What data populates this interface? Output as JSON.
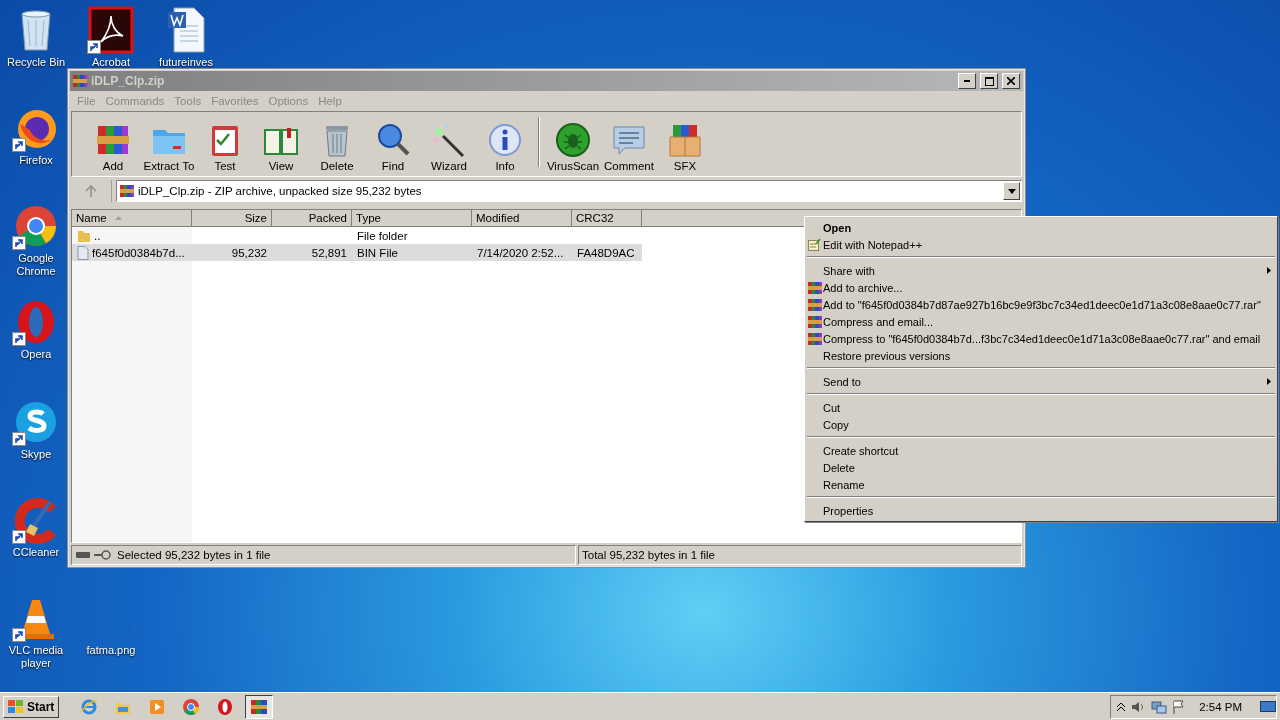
{
  "desktop_icons": [
    {
      "label": "Recycle Bin",
      "kind": "recycle",
      "shortcut": false
    },
    {
      "label": "Acrobat",
      "kind": "acrobat",
      "shortcut": true
    },
    {
      "label": "futureinves",
      "kind": "word",
      "shortcut": false
    },
    {
      "label": "Firefox",
      "kind": "firefox",
      "shortcut": true
    },
    {
      "label": "Google Chrome",
      "kind": "chrome",
      "shortcut": true
    },
    {
      "label": "Opera",
      "kind": "opera",
      "shortcut": true
    },
    {
      "label": "Skype",
      "kind": "skype",
      "shortcut": true
    },
    {
      "label": "CCleaner",
      "kind": "ccleaner",
      "shortcut": true
    },
    {
      "label": "VLC media player",
      "kind": "vlc",
      "shortcut": true
    },
    {
      "label": "fatma.png",
      "kind": "image",
      "shortcut": false
    }
  ],
  "window": {
    "title": "iDLP_Clp.zip",
    "menu": [
      {
        "label": "File",
        "disabled": true
      },
      {
        "label": "Commands",
        "disabled": true
      },
      {
        "label": "Tools",
        "disabled": true
      },
      {
        "label": "Favorites",
        "disabled": true
      },
      {
        "label": "Options",
        "disabled": true
      },
      {
        "label": "Help",
        "disabled": true
      }
    ],
    "toolbar": [
      {
        "label": "Add",
        "kind": "add"
      },
      {
        "label": "Extract To",
        "kind": "extract"
      },
      {
        "label": "Test",
        "kind": "test"
      },
      {
        "label": "View",
        "kind": "view"
      },
      {
        "label": "Delete",
        "kind": "delete"
      },
      {
        "label": "Find",
        "kind": "find"
      },
      {
        "label": "Wizard",
        "kind": "wizard"
      },
      {
        "label": "Info",
        "kind": "info"
      },
      {
        "kind": "separator"
      },
      {
        "label": "VirusScan",
        "kind": "virus"
      },
      {
        "label": "Comment",
        "kind": "comment"
      },
      {
        "label": "SFX",
        "kind": "sfx"
      }
    ],
    "address": "iDLP_Clp.zip - ZIP archive, unpacked size 95,232 bytes",
    "columns": [
      {
        "label": "Name",
        "sorted": true
      },
      {
        "label": "Size",
        "sorted": false
      },
      {
        "label": "Packed",
        "sorted": false
      },
      {
        "label": "Type",
        "sorted": false
      },
      {
        "label": "Modified",
        "sorted": false
      },
      {
        "label": "CRC32",
        "sorted": false
      }
    ],
    "rows": [
      {
        "kind": "folder",
        "name": "..",
        "type": "File folder",
        "selected": false
      },
      {
        "kind": "file",
        "name": "f645f0d0384b7d...",
        "size": "95,232",
        "packed": "52,891",
        "type": "BIN File",
        "modified": "7/14/2020 2:52...",
        "crc32": "FA48D9AC",
        "selected": true
      }
    ],
    "status_left": "Selected 95,232 bytes in 1 file",
    "status_right": "Total 95,232 bytes in 1 file"
  },
  "context_menu": [
    {
      "kind": "item",
      "label": "Open",
      "default": true
    },
    {
      "kind": "notepad_item",
      "label": "Edit with Notepad++"
    },
    {
      "kind": "separator"
    },
    {
      "kind": "item",
      "label": "Share with",
      "submenu": true
    },
    {
      "kind": "archive_item",
      "label": "Add to archive..."
    },
    {
      "kind": "archive_item",
      "label": "Add to \"f645f0d0384b7d87ae927b16bc9e9f3bc7c34ed1deec0e1d71a3c08e8aae0c77.rar\""
    },
    {
      "kind": "archive_item",
      "label": "Compress and email..."
    },
    {
      "kind": "archive_item",
      "label": "Compress to \"f645f0d0384b7d...f3bc7c34ed1deec0e1d71a3c08e8aae0c77.rar\" and email"
    },
    {
      "kind": "item",
      "label": "Restore previous versions"
    },
    {
      "kind": "separator"
    },
    {
      "kind": "item",
      "label": "Send to",
      "submenu": true
    },
    {
      "kind": "separator"
    },
    {
      "kind": "item",
      "label": "Cut"
    },
    {
      "kind": "item",
      "label": "Copy"
    },
    {
      "kind": "separator"
    },
    {
      "kind": "item",
      "label": "Create shortcut"
    },
    {
      "kind": "item",
      "label": "Delete"
    },
    {
      "kind": "item",
      "label": "Rename"
    },
    {
      "kind": "separator"
    },
    {
      "kind": "item",
      "label": "Properties"
    }
  ],
  "taskbar": {
    "start": "Start",
    "apps": [
      {
        "kind": "ie",
        "active": false
      },
      {
        "kind": "explorer",
        "active": false
      },
      {
        "kind": "media",
        "active": false
      },
      {
        "kind": "chrome",
        "active": false
      },
      {
        "kind": "opera",
        "active": false
      },
      {
        "kind": "winrar",
        "active": true
      }
    ],
    "clock": "2:54 PM"
  }
}
